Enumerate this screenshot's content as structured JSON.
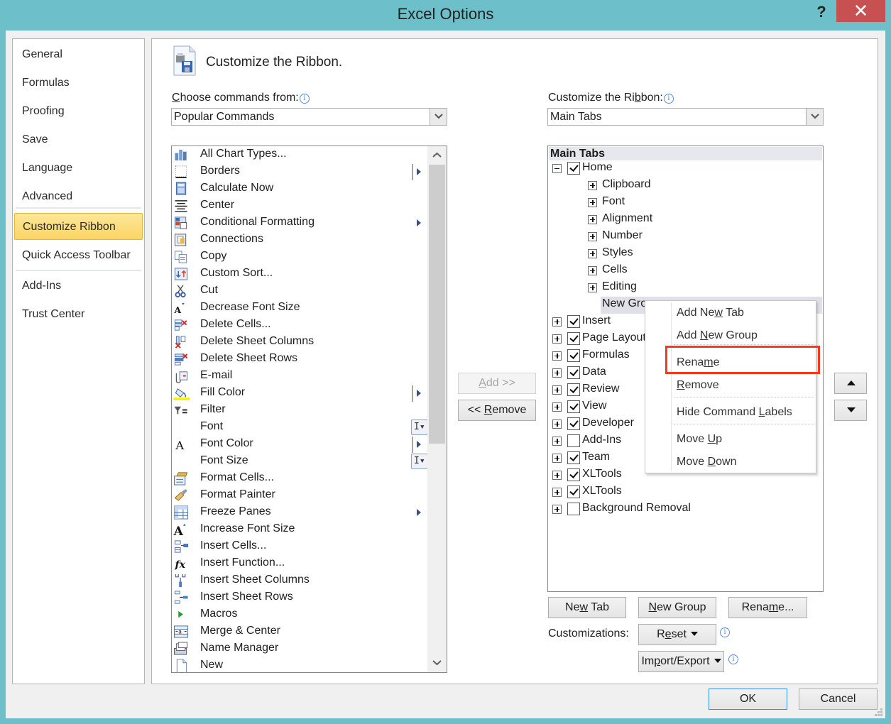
{
  "window": {
    "title": "Excel Options",
    "help_label": "?",
    "close_label": "✕"
  },
  "nav": {
    "items": [
      {
        "label": "General"
      },
      {
        "label": "Formulas"
      },
      {
        "label": "Proofing"
      },
      {
        "label": "Save"
      },
      {
        "label": "Language"
      },
      {
        "label": "Advanced"
      },
      {
        "label": "Customize Ribbon",
        "selected": true
      },
      {
        "label": "Quick Access Toolbar"
      },
      {
        "label": "Add-Ins"
      },
      {
        "label": "Trust Center"
      }
    ]
  },
  "main": {
    "heading": "Customize the Ribbon.",
    "heading_icon": "customize-ribbon-icon",
    "choose_label_prefix": "C",
    "choose_label_rest": "hoose commands from:",
    "choose_value": "Popular Commands",
    "ribbon_label_prefix": "Customize the Ri",
    "ribbon_label_ul": "b",
    "ribbon_label_rest": "bon:",
    "ribbon_value": "Main Tabs",
    "info_glyph": "i"
  },
  "commands": [
    {
      "label": "All Chart Types...",
      "icon": "chart-icon"
    },
    {
      "label": "Borders",
      "icon": "borders-icon",
      "submenu": true,
      "bar": true
    },
    {
      "label": "Calculate Now",
      "icon": "calculator-icon"
    },
    {
      "label": "Center",
      "icon": "align-center-icon"
    },
    {
      "label": "Conditional Formatting",
      "icon": "conditional-formatting-icon",
      "submenu": true
    },
    {
      "label": "Connections",
      "icon": "connections-icon"
    },
    {
      "label": "Copy",
      "icon": "copy-icon"
    },
    {
      "label": "Custom Sort...",
      "icon": "sort-icon"
    },
    {
      "label": "Cut",
      "icon": "scissors-icon"
    },
    {
      "label": "Decrease Font Size",
      "icon": "decrease-font-icon"
    },
    {
      "label": "Delete Cells...",
      "icon": "delete-cells-icon"
    },
    {
      "label": "Delete Sheet Columns",
      "icon": "delete-columns-icon"
    },
    {
      "label": "Delete Sheet Rows",
      "icon": "delete-rows-icon"
    },
    {
      "label": "E-mail",
      "icon": "email-icon"
    },
    {
      "label": "Fill Color",
      "icon": "fill-color-icon",
      "submenu": true,
      "bar": true
    },
    {
      "label": "Filter",
      "icon": "filter-icon"
    },
    {
      "label": "Font",
      "icon": "",
      "ibeam": true
    },
    {
      "label": "Font Color",
      "icon": "font-color-icon",
      "submenu": true,
      "bar": true
    },
    {
      "label": "Font Size",
      "icon": "",
      "ibeam": true
    },
    {
      "label": "Format Cells...",
      "icon": "format-cells-icon"
    },
    {
      "label": "Format Painter",
      "icon": "format-painter-icon"
    },
    {
      "label": "Freeze Panes",
      "icon": "freeze-panes-icon",
      "submenu": true
    },
    {
      "label": "Increase Font Size",
      "icon": "increase-font-icon"
    },
    {
      "label": "Insert Cells...",
      "icon": "insert-cells-icon"
    },
    {
      "label": "Insert Function...",
      "icon": "function-icon"
    },
    {
      "label": "Insert Sheet Columns",
      "icon": "insert-columns-icon"
    },
    {
      "label": "Insert Sheet Rows",
      "icon": "insert-rows-icon"
    },
    {
      "label": "Macros",
      "icon": "macro-play-icon"
    },
    {
      "label": "Merge & Center",
      "icon": "merge-center-icon"
    },
    {
      "label": "Name Manager",
      "icon": "name-manager-icon"
    },
    {
      "label": "New",
      "icon": "new-document-icon"
    }
  ],
  "middle_buttons": {
    "add_ul": "A",
    "add_rest": "dd >>",
    "remove_pre": "<< ",
    "remove_ul": "R",
    "remove_rest": "emove"
  },
  "tree": {
    "header": "Main Tabs",
    "home": {
      "label": "Home",
      "checked": true,
      "expanded": true
    },
    "home_groups": [
      "Clipboard",
      "Font",
      "Alignment",
      "Number",
      "Styles",
      "Cells",
      "Editing"
    ],
    "new_group_label": "New Group (Custom)",
    "new_group_visible": "New Gro",
    "tabs": [
      {
        "label": "Insert",
        "checked": true
      },
      {
        "label": "Page Layout",
        "checked": true
      },
      {
        "label": "Formulas",
        "checked": true
      },
      {
        "label": "Data",
        "checked": true
      },
      {
        "label": "Review",
        "checked": true
      },
      {
        "label": "View",
        "checked": true
      },
      {
        "label": "Developer",
        "checked": true
      },
      {
        "label": "Add-Ins",
        "checked": false
      },
      {
        "label": "Team",
        "checked": true
      },
      {
        "label": "XLTools",
        "checked": true
      },
      {
        "label": "XLTools",
        "checked": true
      },
      {
        "label": "Background Removal",
        "checked": false
      }
    ]
  },
  "context_menu": {
    "items": [
      {
        "pre": "Add Ne",
        "ul": "w",
        "post": " Tab"
      },
      {
        "pre": "Add ",
        "ul": "N",
        "post": "ew Group"
      },
      {
        "pre": "Rena",
        "ul": "m",
        "post": "e",
        "highlighted": true
      },
      {
        "pre": "",
        "ul": "R",
        "post": "emove"
      },
      {
        "pre": "Hide Command ",
        "ul": "L",
        "post": "abels"
      },
      {
        "pre": "Move ",
        "ul": "U",
        "post": "p"
      },
      {
        "pre": "Move ",
        "ul": "D",
        "post": "own"
      }
    ],
    "highlight_color": "#f23a1c"
  },
  "bottom": {
    "new_tab": {
      "pre": "Ne",
      "ul": "w",
      "post": " Tab"
    },
    "new_group": {
      "pre": "",
      "ul": "N",
      "post": "ew Group"
    },
    "rename": {
      "pre": "Rena",
      "ul": "m",
      "post": "e..."
    },
    "customizations_label": "Customizations:",
    "reset": {
      "pre": "R",
      "ul": "e",
      "post": "set"
    },
    "import_export": {
      "pre": "Im",
      "ul": "p",
      "post": "ort/Export"
    },
    "ok_label": "OK",
    "cancel_label": "Cancel"
  },
  "colors": {
    "window_frame": "#6dc0ca",
    "close_button": "#c75050",
    "selected_nav": "#fbd464",
    "ok_border": "#3c8fe0"
  }
}
